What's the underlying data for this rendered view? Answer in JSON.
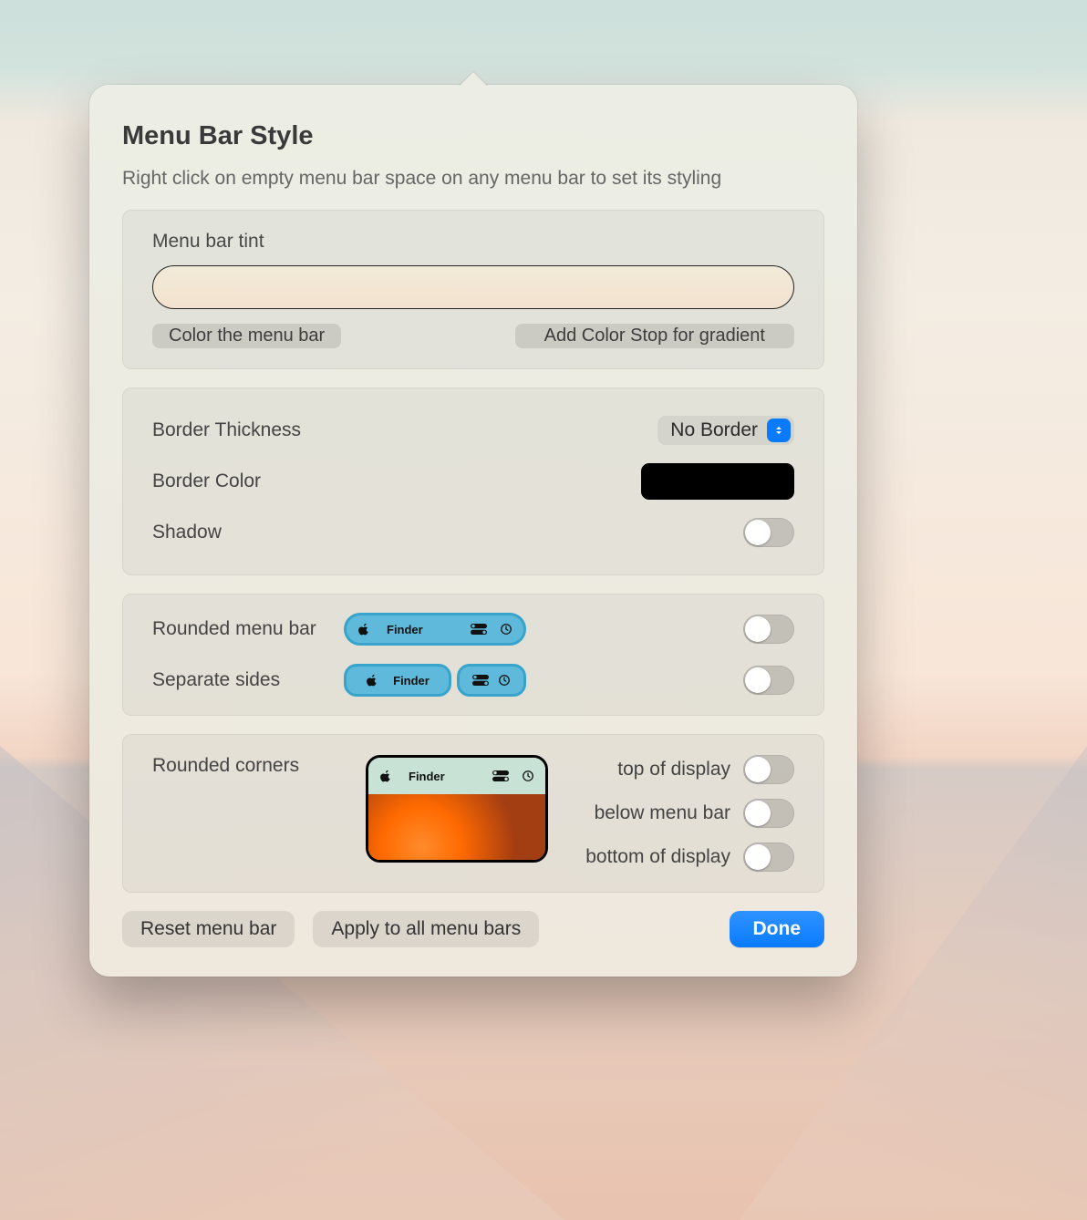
{
  "title": "Menu Bar Style",
  "subtitle": "Right click on empty menu bar space on any menu bar to set its styling",
  "tint": {
    "label": "Menu bar tint",
    "color_btn": "Color the menu bar",
    "stop_btn": "Add Color Stop for gradient"
  },
  "border": {
    "thickness_label": "Border Thickness",
    "thickness_value": "No Border",
    "color_label": "Border Color",
    "color_value": "#000000",
    "shadow_label": "Shadow",
    "shadow_on": false
  },
  "rounded": {
    "menu_bar_label": "Rounded menu bar",
    "menu_bar_on": false,
    "separate_label": "Separate sides",
    "separate_on": false,
    "preview_text": "Finder"
  },
  "corners": {
    "label": "Rounded corners",
    "preview_text": "Finder",
    "opts": [
      {
        "label": "top of display",
        "on": false
      },
      {
        "label": "below menu bar",
        "on": false
      },
      {
        "label": "bottom of display",
        "on": false
      }
    ]
  },
  "footer": {
    "reset": "Reset menu bar",
    "apply_all": "Apply to all menu bars",
    "done": "Done"
  }
}
